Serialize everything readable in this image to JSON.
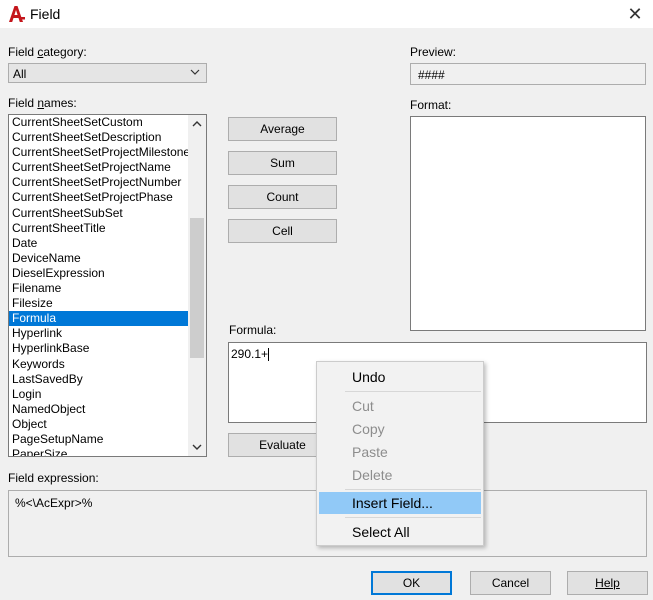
{
  "window": {
    "title": "Field"
  },
  "field_category": {
    "label_pre": "Field ",
    "label_ul": "c",
    "label_post": "ategory:",
    "selected": "All"
  },
  "field_names": {
    "label_pre": "Field ",
    "label_ul": "n",
    "label_post": "ames:",
    "items": [
      "CurrentSheetSetCustom",
      "CurrentSheetSetDescription",
      "CurrentSheetSetProjectMilestone",
      "CurrentSheetSetProjectName",
      "CurrentSheetSetProjectNumber",
      "CurrentSheetSetProjectPhase",
      "CurrentSheetSubSet",
      "CurrentSheetTitle",
      "Date",
      "DeviceName",
      "DieselExpression",
      "Filename",
      "Filesize",
      "Formula",
      "Hyperlink",
      "HyperlinkBase",
      "Keywords",
      "LastSavedBy",
      "Login",
      "NamedObject",
      "Object",
      "PageSetupName",
      "PaperSize"
    ],
    "selected": "Formula"
  },
  "buttons": {
    "average": "Average",
    "sum": "Sum",
    "count": "Count",
    "cell": "Cell",
    "evaluate": "Evaluate",
    "ok": "OK",
    "cancel": "Cancel",
    "help": "Help"
  },
  "preview": {
    "label": "Preview:",
    "value": "####"
  },
  "format": {
    "label": "Format:"
  },
  "formula": {
    "label": "Formula:",
    "value": "290.1+"
  },
  "field_expression": {
    "label": "Field expression:",
    "value": "%<\\AcExpr>%"
  },
  "context_menu": {
    "undo": "Undo",
    "cut": "Cut",
    "copy": "Copy",
    "paste": "Paste",
    "delete": "Delete",
    "insert_field": "Insert Field...",
    "select_all": "Select All"
  },
  "colors": {
    "selection": "#0078d7",
    "menu_highlight": "#91c9f7",
    "app_icon": "#c4161c"
  }
}
